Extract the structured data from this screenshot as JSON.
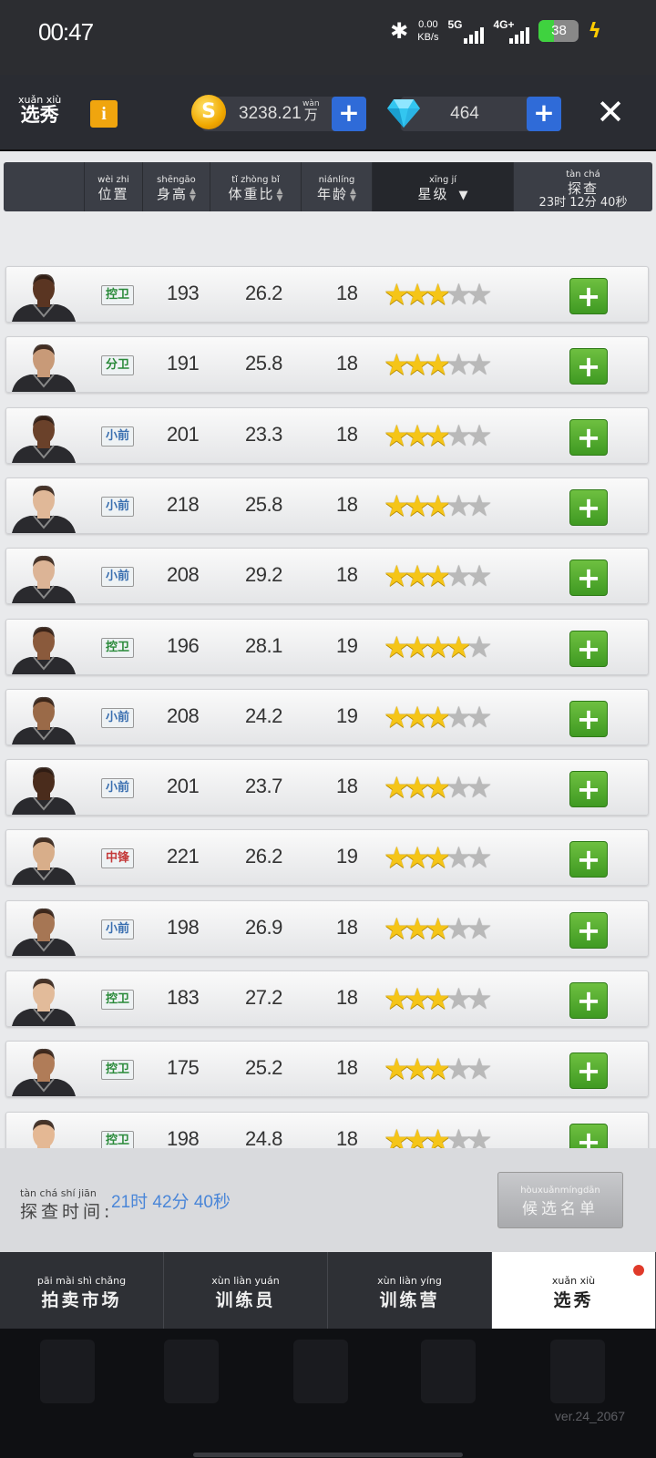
{
  "status_bar": {
    "time": "00:47",
    "net_speed_value": "0.00",
    "net_speed_unit": "KB/s",
    "net1": "5G",
    "net2": "4G+",
    "battery": "38",
    "battery_level": 0.38
  },
  "header": {
    "title_py": "xuǎn xiù",
    "title": "选秀",
    "info_label": "i",
    "coins": "3238.21",
    "coin_unit_py": "wàn",
    "coin_unit": "万",
    "diamonds": "464",
    "plus": "+",
    "close": "✕",
    "coin_symbol": "S"
  },
  "columns": {
    "position": {
      "py": "wèi zhi",
      "cn": "位置"
    },
    "height": {
      "py": "shēngāo",
      "cn": "身高"
    },
    "ratio": {
      "py": "tǐ zhòng bǐ",
      "cn": "体重比"
    },
    "age": {
      "py": "niánlíng",
      "cn": "年龄"
    },
    "stars": {
      "py": "xīng jí",
      "cn": "星级",
      "arrow": "▼"
    },
    "scout": {
      "py": "tàn chá",
      "cn": "探查",
      "time": "23时 12分 40秒"
    }
  },
  "players": [
    {
      "position": "控卫",
      "pos_color": "green",
      "height": "193",
      "ratio": "26.2",
      "age": "18",
      "stars": 3,
      "skin": "#5a3522"
    },
    {
      "position": "分卫",
      "pos_color": "green",
      "height": "191",
      "ratio": "25.8",
      "age": "18",
      "stars": 3,
      "skin": "#c89a78"
    },
    {
      "position": "小前",
      "pos_color": "blue",
      "height": "201",
      "ratio": "23.3",
      "age": "18",
      "stars": 3,
      "skin": "#6a412a"
    },
    {
      "position": "小前",
      "pos_color": "blue",
      "height": "218",
      "ratio": "25.8",
      "age": "18",
      "stars": 3,
      "skin": "#e0b898"
    },
    {
      "position": "小前",
      "pos_color": "blue",
      "height": "208",
      "ratio": "29.2",
      "age": "18",
      "stars": 3,
      "skin": "#dcb496"
    },
    {
      "position": "控卫",
      "pos_color": "green",
      "height": "196",
      "ratio": "28.1",
      "age": "19",
      "stars": 4,
      "skin": "#8a5a3c"
    },
    {
      "position": "小前",
      "pos_color": "blue",
      "height": "208",
      "ratio": "24.2",
      "age": "19",
      "stars": 3,
      "skin": "#9a6a48"
    },
    {
      "position": "小前",
      "pos_color": "blue",
      "height": "201",
      "ratio": "23.7",
      "age": "18",
      "stars": 3,
      "skin": "#4a2c1c"
    },
    {
      "position": "中锋",
      "pos_color": "red",
      "height": "221",
      "ratio": "26.2",
      "age": "19",
      "stars": 3,
      "skin": "#d8ae8a"
    },
    {
      "position": "小前",
      "pos_color": "blue",
      "height": "198",
      "ratio": "26.9",
      "age": "18",
      "stars": 3,
      "skin": "#a67654"
    },
    {
      "position": "控卫",
      "pos_color": "green",
      "height": "183",
      "ratio": "27.2",
      "age": "18",
      "stars": 3,
      "skin": "#e2bb9a"
    },
    {
      "position": "控卫",
      "pos_color": "green",
      "height": "175",
      "ratio": "25.2",
      "age": "18",
      "stars": 3,
      "skin": "#b07c58"
    },
    {
      "position": "控卫",
      "pos_color": "green",
      "height": "198",
      "ratio": "24.8",
      "age": "18",
      "stars": 3,
      "skin": "#e4b894"
    }
  ],
  "footer": {
    "label_py": "tàn chá shí jiān",
    "label": "探查时间:",
    "value": "21时 42分 40秒",
    "candidate_py": "hòuxuǎnmíngdān",
    "candidate": "候选名单"
  },
  "tabs": [
    {
      "py": "pāi mài shì chǎng",
      "cn": "拍卖市场"
    },
    {
      "py": "xùn liàn yuán",
      "cn": "训练员"
    },
    {
      "py": "xùn liàn yíng",
      "cn": "训练营"
    },
    {
      "py": "xuǎn xiù",
      "cn": "选秀"
    }
  ],
  "version": "ver.24_2067"
}
